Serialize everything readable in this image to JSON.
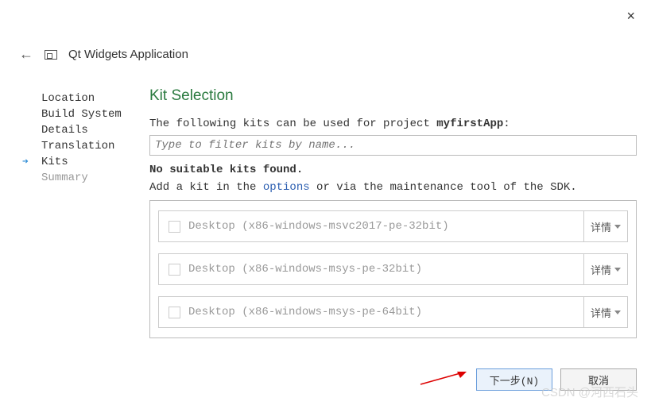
{
  "window": {
    "close_tooltip": "Close"
  },
  "header": {
    "title": "Qt Widgets Application"
  },
  "sidebar": {
    "items": [
      {
        "label": "Location",
        "state": "done"
      },
      {
        "label": "Build System",
        "state": "done"
      },
      {
        "label": "Details",
        "state": "done"
      },
      {
        "label": "Translation",
        "state": "done"
      },
      {
        "label": "Kits",
        "state": "active"
      },
      {
        "label": "Summary",
        "state": "disabled"
      }
    ]
  },
  "main": {
    "title": "Kit Selection",
    "intro_prefix": "The following kits can be used for project ",
    "project_name": "myfirstApp",
    "intro_suffix": ":",
    "filter_placeholder": "Type to filter kits by name...",
    "warning": "No suitable kits found.",
    "hint_prefix": "Add a kit in the ",
    "hint_link": "options",
    "hint_suffix": " or via the maintenance tool of the SDK.",
    "details_label": "详情",
    "kits": [
      {
        "label": "Desktop (x86-windows-msvc2017-pe-32bit)",
        "checked": false
      },
      {
        "label": "Desktop (x86-windows-msys-pe-32bit)",
        "checked": false
      },
      {
        "label": "Desktop (x86-windows-msys-pe-64bit)",
        "checked": false
      }
    ]
  },
  "footer": {
    "next": "下一步(N)",
    "cancel": "取消"
  },
  "watermark": "CSDN @河西石头"
}
